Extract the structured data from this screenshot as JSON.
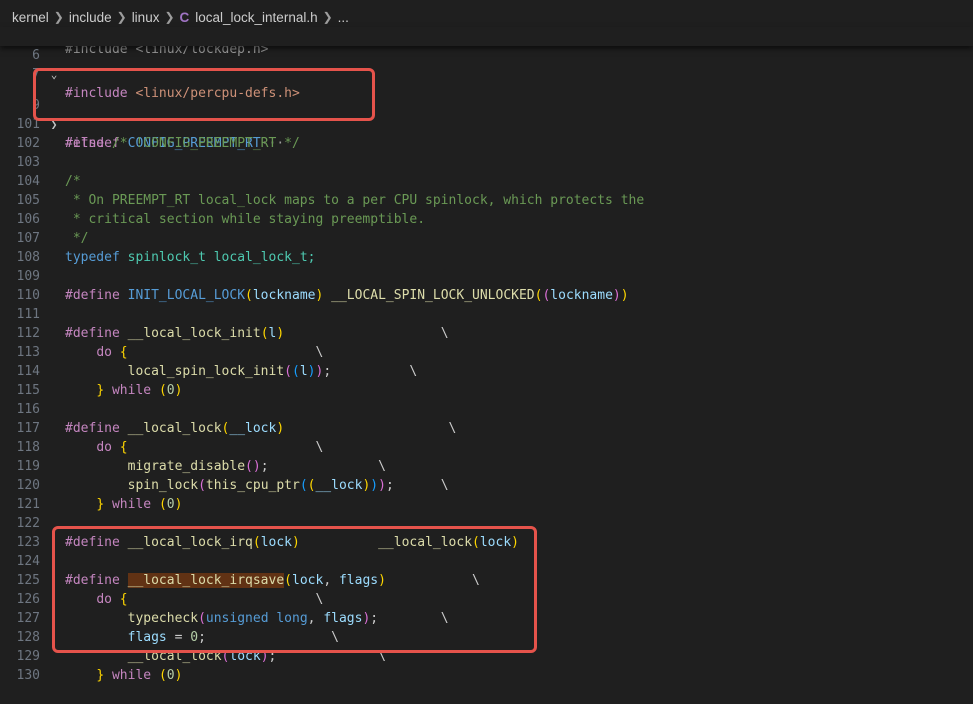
{
  "breadcrumb": {
    "items": [
      "kernel",
      "include",
      "linux",
      "local_lock_internal.h",
      "..."
    ],
    "file_icon": "C"
  },
  "sticky": {
    "line_number": "6",
    "text": "#include <linux/percpu-defs.h>"
  },
  "peek_text": "#include <linux/lockdep.h>",
  "lines": [
    {
      "n": "7",
      "html": ""
    },
    {
      "n": "",
      "fold": true
    },
    {
      "n": "101"
    },
    {
      "n": "102"
    },
    {
      "n": "103"
    },
    {
      "n": "104"
    },
    {
      "n": "105"
    },
    {
      "n": "106"
    },
    {
      "n": "107"
    },
    {
      "n": "108"
    },
    {
      "n": "109"
    },
    {
      "n": "110"
    },
    {
      "n": "111"
    },
    {
      "n": "112"
    },
    {
      "n": "113"
    },
    {
      "n": "114"
    },
    {
      "n": "115"
    },
    {
      "n": "116"
    },
    {
      "n": "117"
    },
    {
      "n": "118"
    },
    {
      "n": "119"
    },
    {
      "n": "120"
    },
    {
      "n": "121"
    },
    {
      "n": "122"
    },
    {
      "n": "123"
    },
    {
      "n": "124"
    },
    {
      "n": "125"
    },
    {
      "n": "126"
    },
    {
      "n": "127"
    },
    {
      "n": "128"
    },
    {
      "n": "129"
    },
    {
      "n": "130"
    }
  ],
  "code": {
    "l_ifndef": {
      "kw": "#ifndef",
      "macro": "CONFIG_PREEMPT_RT",
      "ellipsis": "···"
    },
    "l101": {
      "kw": "#else",
      "comment": "/* !CONFIG_PREEMPT_RT */"
    },
    "l103": "/*",
    "l104": " * On PREEMPT_RT local_lock maps to a per CPU spinlock, which protects the",
    "l105": " * critical section while staying preemptible.",
    "l106": " */",
    "l107": {
      "kw": "typedef",
      "type": "spinlock_t",
      "name": "local_lock_t;"
    },
    "l109": {
      "kw": "#define",
      "macro": "INIT_LOCAL_LOCK",
      "p1": "(",
      "arg": "lockname",
      "p1c": ")",
      "body": "__LOCAL_SPIN_LOCK_UNLOCKED",
      "b1": "(",
      "b2": "(",
      "barg": "lockname",
      "b2c": ")",
      "b1c": ")"
    },
    "l111": {
      "kw": "#define",
      "fn": "__local_lock_init",
      "o": "(",
      "arg": "l",
      "c": ")",
      "bs": "\\"
    },
    "l112": {
      "kw": "do",
      "brace": "{",
      "bs": "\\"
    },
    "l113": {
      "fn": "local_spin_lock_init",
      "o": "(",
      "o2": "(",
      "arg": "l",
      "c2": ")",
      "c": ")",
      "semi": ";",
      "bs": "\\"
    },
    "l114": {
      "brace": "}",
      "kw": "while",
      "o": "(",
      "num": "0",
      "c": ")"
    },
    "l116": {
      "kw": "#define",
      "fn": "__local_lock",
      "o": "(",
      "arg": "__lock",
      "c": ")",
      "bs": "\\"
    },
    "l117": {
      "kw": "do",
      "brace": "{",
      "bs": "\\"
    },
    "l118": {
      "fn": "migrate_disable",
      "oc": "()",
      "semi": ";",
      "bs": "\\"
    },
    "l119": {
      "fn": "spin_lock",
      "o": "(",
      "fn2": "this_cpu_ptr",
      "o2": "(",
      "o3": "(",
      "arg": "__lock",
      "c3": ")",
      "c2": ")",
      "c": ")",
      "semi": ";",
      "bs": "\\"
    },
    "l120": {
      "brace": "}",
      "kw": "while",
      "o": "(",
      "num": "0",
      "c": ")"
    },
    "l122": {
      "kw": "#define",
      "fn": "__local_lock_irq",
      "o": "(",
      "arg": "lock",
      "c": ")",
      "body": "__local_lock",
      "bo": "(",
      "barg": "lock",
      "bc": ")"
    },
    "l124": {
      "kw": "#define",
      "fn": "__local_lock_irqsave",
      "o": "(",
      "arg1": "lock",
      "comma": ",",
      "arg2": "flags",
      "c": ")",
      "bs": "\\"
    },
    "l125": {
      "kw": "do",
      "brace": "{",
      "bs": "\\"
    },
    "l126": {
      "fn": "typecheck",
      "o": "(",
      "t1": "unsigned",
      "t2": "long",
      "comma": ",",
      "arg": "flags",
      "c": ")",
      "semi": ";",
      "bs": "\\"
    },
    "l127": {
      "var": "flags",
      "eq": "=",
      "num": "0",
      "semi": ";",
      "bs": "\\"
    },
    "l128": {
      "fn": "__local_lock",
      "o": "(",
      "arg": "lock",
      "c": ")",
      "semi": ";",
      "bs": "\\"
    },
    "l129": {
      "brace": "}",
      "kw": "while",
      "o": "(",
      "num": "0",
      "c": ")"
    }
  },
  "fold_line_number": "9",
  "colors": {
    "background": "#1f1f1f",
    "annotation_box": "#e5534b",
    "highlight": "#613214"
  }
}
